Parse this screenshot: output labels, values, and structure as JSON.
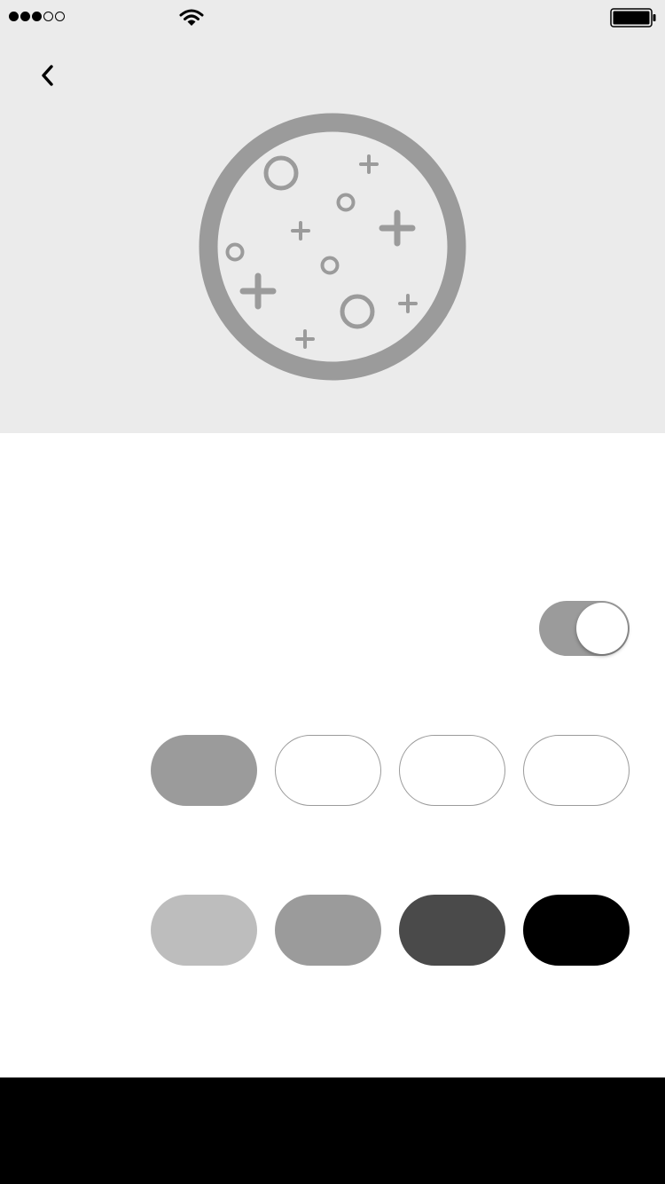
{
  "status_bar": {
    "signal_strength": 3,
    "signal_max": 5,
    "wifi_icon": "wifi-icon",
    "battery_icon": "battery-icon",
    "battery_level": 1.0
  },
  "header": {
    "back_icon": "chevron-left-icon",
    "background_color": "#ebebeb",
    "illustration_icon": "sparkle-circle-icon",
    "illustration_color": "#9b9b9b"
  },
  "settings": {
    "toggle_on": true,
    "toggle_track_color": "#9b9b9b",
    "size_options": [
      {
        "selected": true,
        "color": "#9b9b9b"
      },
      {
        "selected": false,
        "color": "#ffffff"
      },
      {
        "selected": false,
        "color": "#ffffff"
      },
      {
        "selected": false,
        "color": "#ffffff"
      }
    ],
    "color_options": [
      {
        "color": "#bdbdbd"
      },
      {
        "color": "#9b9b9b"
      },
      {
        "color": "#4a4a4a"
      },
      {
        "color": "#000000"
      }
    ]
  },
  "bottom_bar": {
    "color": "#000000"
  }
}
